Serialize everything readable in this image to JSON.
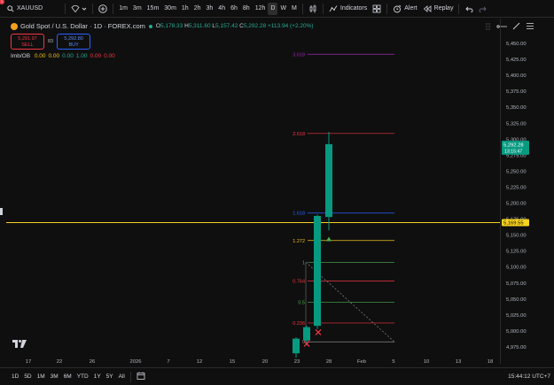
{
  "topbar": {
    "symbol": "XAUUSD",
    "timeframes": [
      "1m",
      "3m",
      "15m",
      "30m",
      "1h",
      "2h",
      "3h",
      "4h",
      "6h",
      "8h",
      "12h",
      "D",
      "W",
      "M"
    ],
    "active_timeframe": "D",
    "indicators_label": "Indicators",
    "alert_label": "Alert",
    "replay_label": "Replay",
    "notification_count": "1"
  },
  "legend": {
    "title": "Gold Spot / U.S. Dollar · 1D · FOREX.com",
    "open_k": "O",
    "open_v": "5,178.33",
    "high_k": "H",
    "high_v": "5,311.60",
    "low_k": "L",
    "low_v": "5,157.42",
    "close_k": "C",
    "close_v": "5,292.28",
    "change": "+113.94 (+2.20%)"
  },
  "trade": {
    "sell_price": "5,291.97",
    "sell_label": "SELL",
    "spread": "83",
    "buy_price": "5,292.80",
    "buy_label": "BUY"
  },
  "indicator": {
    "name": "Imb/OB",
    "values": [
      "0.00",
      "0.00",
      "0.00",
      "1.00",
      "0.00",
      "0.00"
    ],
    "colors": [
      "#f0c020",
      "#f0c020",
      "#22ab94",
      "#22ab94",
      "#f23645",
      "#f23645"
    ]
  },
  "price_axis": {
    "ticks": [
      "5,450.00",
      "5,425.00",
      "5,400.00",
      "5,375.00",
      "5,350.00",
      "5,325.00",
      "5,300.00",
      "5,275.00",
      "5,250.00",
      "5,225.00",
      "5,200.00",
      "5,175.00",
      "5,150.00",
      "5,125.00",
      "5,100.00",
      "5,075.00",
      "5,050.00",
      "5,025.00",
      "5,000.00",
      "4,975.00"
    ],
    "current_price": "5,292.28",
    "countdown": "13:15:47",
    "hline_price": "5,169.55"
  },
  "time_axis": {
    "ticks": [
      "17",
      "22",
      "26",
      "2026",
      "7",
      "12",
      "15",
      "20",
      "23",
      "28",
      "Feb",
      "5",
      "10",
      "13",
      "18",
      "23"
    ]
  },
  "fib_levels": [
    {
      "label": "3.618",
      "price": 5433.0,
      "color": "#9c27b0"
    },
    {
      "label": "2.618",
      "price": 5309.0,
      "color": "#f23645"
    },
    {
      "label": "1.618",
      "price": 5184.5,
      "color": "#2962ff"
    },
    {
      "label": "1.272",
      "price": 5141.5,
      "color": "#f0c020"
    },
    {
      "label": "1",
      "price": 5107.5,
      "color": "#4caf50"
    },
    {
      "label": "0.764",
      "price": 5078.0,
      "color": "#f23645"
    },
    {
      "label": "0.5",
      "price": 5045.0,
      "color": "#4caf50"
    },
    {
      "label": "0.236",
      "price": 5012.5,
      "color": "#f23645"
    },
    {
      "label": "0",
      "price": 4983.0,
      "color": "#888888"
    }
  ],
  "candles": [
    {
      "date": "Jan 22",
      "open": 4965,
      "high": 4990,
      "low": 4958,
      "close": 4988
    },
    {
      "date": "Jan 23",
      "open": 4985,
      "high": 5008,
      "low": 4978,
      "close": 5006
    },
    {
      "date": "Jan 26",
      "open": 5008,
      "high": 5182,
      "low": 5003,
      "close": 5180
    },
    {
      "date": "Jan 27",
      "open": 5178.33,
      "high": 5311.6,
      "low": 5157.42,
      "close": 5292.28
    }
  ],
  "bottombar": {
    "ranges": [
      "1D",
      "5D",
      "1M",
      "3M",
      "6M",
      "YTD",
      "1Y",
      "5Y",
      "All"
    ],
    "clock": "15:44:12 UTC+7"
  },
  "colors": {
    "bull": "#089981",
    "bg": "#0f0f0f",
    "hline": "#f7d21f"
  }
}
